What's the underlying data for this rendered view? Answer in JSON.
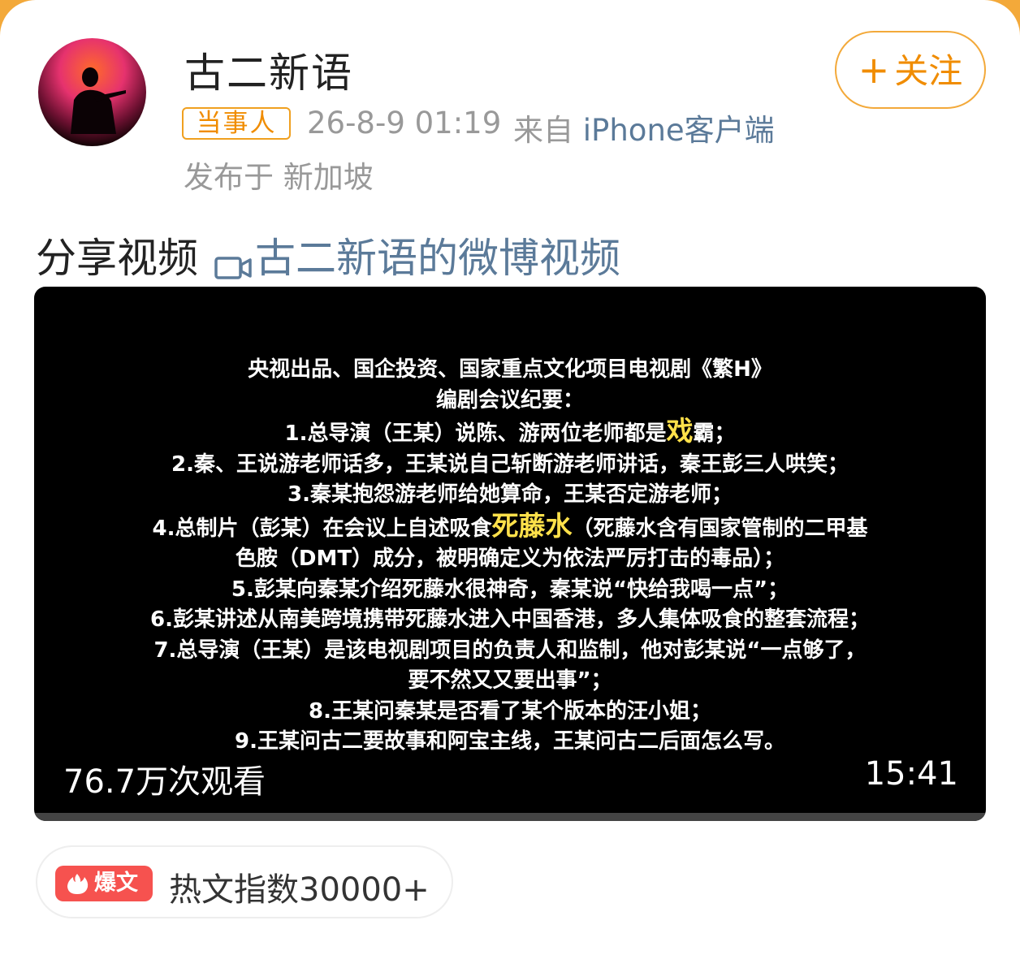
{
  "user": {
    "name": "古二新语",
    "badge": "当事人",
    "time": "26-8-9 01:19",
    "from_prefix": "来自",
    "client": "iPhone客户端",
    "location": "发布于 新加坡"
  },
  "follow": {
    "plus": "+",
    "label": "关注"
  },
  "post": {
    "share_prefix": "分享视频",
    "link_label": "古二新语的微博视频"
  },
  "video": {
    "lines": [
      "央视出品、国企投资、国家重点文化项目电视剧《繁H》",
      "编剧会议纪要：",
      "1.总导演（王某）说陈、游两位老师都是",
      "戏",
      "霸；",
      "2.秦、王说游老师话多，王某说自己斩断游老师讲话，秦王彭三人哄笑；",
      "3.秦某抱怨游老师给她算命，王某否定游老师；",
      "4.总制片（彭某）在会议上自述吸食",
      "死藤水",
      "（死藤水含有国家管制的二甲基",
      "色胺（DMT）成分，被明确定义为依法严厉打击的毒品）；",
      "5.彭某向秦某介绍死藤水很神奇，秦某说“快给我喝一点”；",
      "6.彭某讲述从南美跨境携带死藤水进入中国香港，多人集体吸食的整套流程；",
      "7.总导演（王某）是该电视剧项目的负责人和监制，他对彭某说“一点够了，",
      "要不然又又要出事”；",
      "8.王某问秦某是否看了某个版本的汪小姐；",
      "9.王某问古二要故事和阿宝主线，王某问古二后面怎么写。"
    ],
    "views": "76.7万次观看",
    "duration": "15:41"
  },
  "hot": {
    "tag": "爆文",
    "index": "热文指数30000+"
  },
  "colors": {
    "accent_orange": "#f08c00",
    "link_blue": "#5b7a99",
    "highlight_yellow": "#ffe14a",
    "hot_red": "#f6524f"
  },
  "icons": [
    "avatar",
    "video-camera-icon",
    "fire-icon"
  ]
}
